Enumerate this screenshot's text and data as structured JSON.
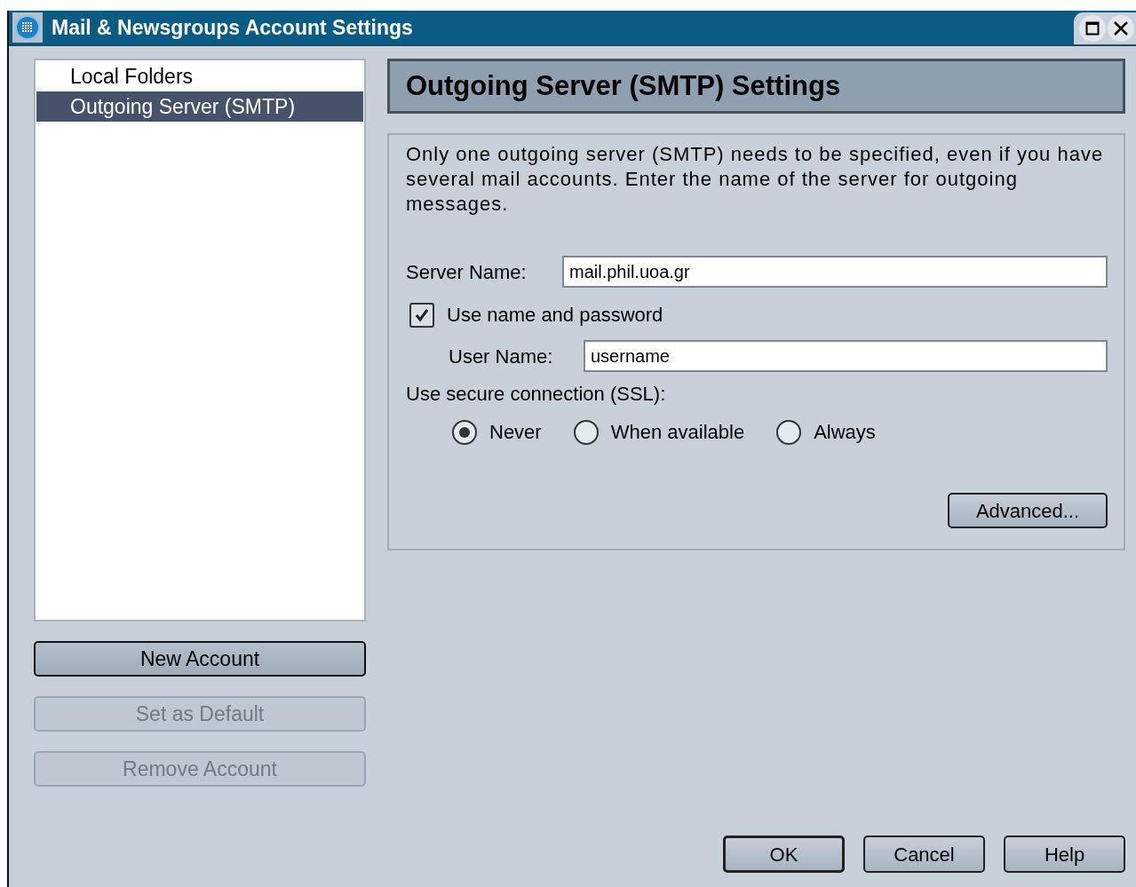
{
  "window": {
    "title": "Mail & Newsgroups Account Settings"
  },
  "accounts": [
    {
      "label": "Local Folders",
      "selected": false
    },
    {
      "label": "Outgoing Server (SMTP)",
      "selected": true
    }
  ],
  "account_buttons": [
    {
      "label": "New Account",
      "disabled": false
    },
    {
      "label": "Set as Default",
      "disabled": true
    },
    {
      "label": "Remove Account",
      "disabled": true
    }
  ],
  "panel": {
    "title": "Outgoing Server (SMTP) Settings",
    "description": "Only one outgoing server (SMTP) needs to be specified, even if you have several mail accounts. Enter the name of the server for outgoing messages.",
    "server_name": {
      "label": "Server Name:",
      "value": "mail.phil.uoa.gr"
    },
    "use_auth": {
      "label": "Use name and password",
      "checked": true
    },
    "user_name": {
      "label": "User Name:",
      "value": "username"
    },
    "ssl": {
      "label": "Use secure connection (SSL):",
      "options": [
        {
          "label": "Never",
          "selected": true
        },
        {
          "label": "When available",
          "selected": false
        },
        {
          "label": "Always",
          "selected": false
        }
      ]
    },
    "advanced_button": "Advanced..."
  },
  "dialog_buttons": [
    {
      "label": "OK",
      "default": true
    },
    {
      "label": "Cancel",
      "default": false
    },
    {
      "label": "Help",
      "default": false
    }
  ]
}
